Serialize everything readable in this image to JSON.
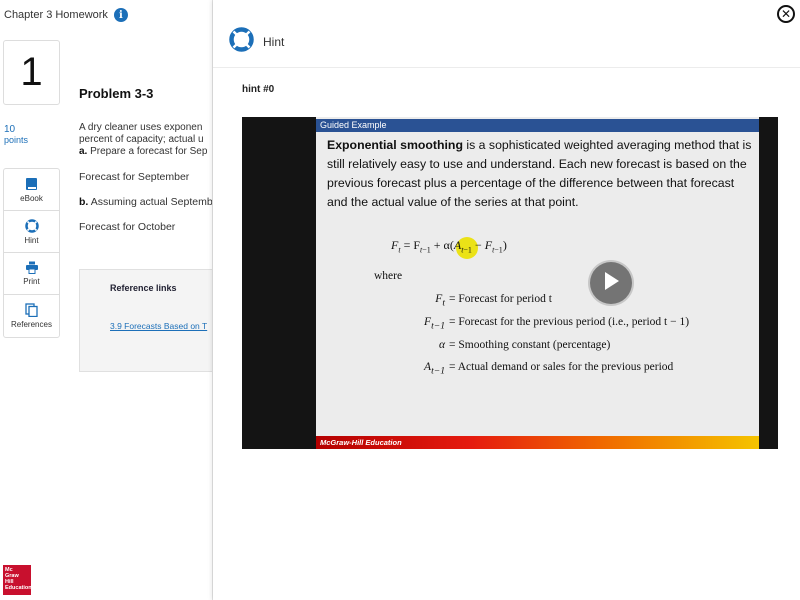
{
  "homework": {
    "title": "Chapter 3 Homework",
    "question_number": "1",
    "points_value": "10",
    "points_label": "points"
  },
  "tools": [
    {
      "label": "eBook",
      "icon": "book-icon"
    },
    {
      "label": "Hint",
      "icon": "lifebuoy-icon"
    },
    {
      "label": "Print",
      "icon": "printer-icon"
    },
    {
      "label": "References",
      "icon": "documents-icon"
    }
  ],
  "problem": {
    "title": "Problem 3-3",
    "line1": "A dry cleaner uses exponen",
    "line2": "percent of capacity; actual u",
    "part_a_label": "a.",
    "part_a_text": "Prepare a forecast for Sep",
    "forecast_september": "Forecast for September",
    "part_b_label": "b.",
    "part_b_text": "Assuming actual Septemb",
    "forecast_october": "Forecast for October"
  },
  "references": {
    "title": "Reference links",
    "link": "3.9 Forecasts Based on T"
  },
  "logo": {
    "line1": "Mc",
    "line2": "Graw",
    "line3": "Hill",
    "line4": "Education"
  },
  "hint_panel": {
    "title": "Hint",
    "close_symbol": "✕",
    "hint_number": "hint #0"
  },
  "video": {
    "header": "Guided Example",
    "bold_term": "Exponential smoothing",
    "body": " is a sophisticated weighted averaging method that is still relatively easy to use and understand. Each new forecast is based on the previous forecast plus a percentage of the difference between that forecast and the actual value of the series at that point.",
    "formula_lhs": "F",
    "formula": "= F",
    "where": "where",
    "definitions": [
      {
        "symbol": "F",
        "sub": "t",
        "text": "= Forecast for period t"
      },
      {
        "symbol": "F",
        "sub": "t−1",
        "text": "= Forecast for the previous period (i.e., period t − 1)"
      },
      {
        "symbol": "α",
        "sub": "",
        "text": "= Smoothing constant (percentage)"
      },
      {
        "symbol": "A",
        "sub": "t−1",
        "text": "= Actual demand or sales for the previous period"
      }
    ],
    "footer": "McGraw-Hill Education"
  },
  "colors": {
    "accent": "#1c6fb8",
    "slide_header": "#2a5294",
    "logo_red": "#c8102e"
  }
}
